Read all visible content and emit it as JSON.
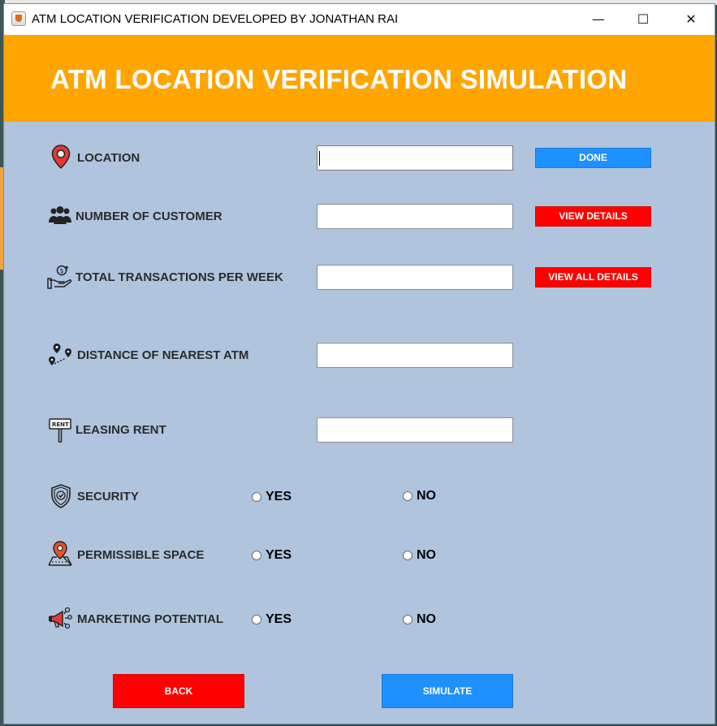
{
  "window": {
    "title": "ATM LOCATION VERIFICATION DEVELOPED BY JONATHAN RAI",
    "controls": {
      "minimize": "—",
      "maximize": "☐",
      "close": "✕"
    }
  },
  "header": {
    "title": "ATM LOCATION VERIFICATION SIMULATION",
    "bg": "#ffa500"
  },
  "fields": {
    "location": {
      "label": "LOCATION",
      "value": ""
    },
    "customers": {
      "label": "NUMBER OF CUSTOMER",
      "value": ""
    },
    "transactions": {
      "label": "TOTAL TRANSACTIONS PER WEEK",
      "value": ""
    },
    "distance": {
      "label": "DISTANCE OF NEAREST ATM",
      "value": ""
    },
    "rent": {
      "label": "LEASING RENT",
      "value": ""
    }
  },
  "buttons": {
    "done": "DONE",
    "view_details": "VIEW DETAILS",
    "view_all_details": "VIEW ALL DETAILS",
    "back": "BACK",
    "simulate": "SIMULATE"
  },
  "radios": {
    "security": {
      "label": "SECURITY",
      "yes": "YES",
      "no": "NO",
      "selected": null
    },
    "permissible": {
      "label": "PERMISSIBLE SPACE",
      "yes": "YES",
      "no": "NO",
      "selected": null
    },
    "marketing": {
      "label": "MARKETING POTENTIAL",
      "yes": "YES",
      "no": "NO",
      "selected": null
    }
  },
  "colors": {
    "panel": "#b0c4de",
    "blue": "#1e90ff",
    "red": "#ff0000"
  }
}
